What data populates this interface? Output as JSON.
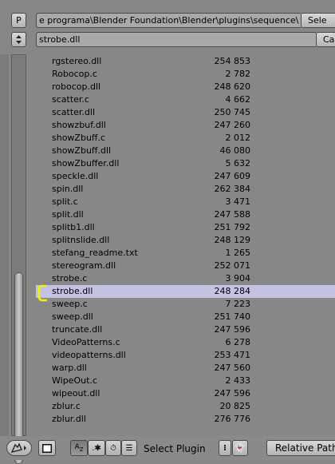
{
  "header": {
    "parent_button_label": "P",
    "directory_path": "e programa\\Blender Foundation\\Blender\\plugins\\sequence\\",
    "select_button_label": "Sele",
    "filename_value": "strobe.dll",
    "cancel_button_label": "Ca"
  },
  "files": [
    {
      "name": "rgstereo.dll",
      "size": "254 853"
    },
    {
      "name": "Robocop.c",
      "size": "2 782"
    },
    {
      "name": "robocop.dll",
      "size": "248 620"
    },
    {
      "name": "scatter.c",
      "size": "4 662"
    },
    {
      "name": "scatter.dll",
      "size": "250 745"
    },
    {
      "name": "showzbuf.dll",
      "size": "247 260"
    },
    {
      "name": "showZbuff.c",
      "size": "2 012"
    },
    {
      "name": "showZbuff.dll",
      "size": "46 080"
    },
    {
      "name": "showZbuffer.dll",
      "size": "5 632"
    },
    {
      "name": "speckle.dll",
      "size": "247 609"
    },
    {
      "name": "spin.dll",
      "size": "262 384"
    },
    {
      "name": "split.c",
      "size": "3 471"
    },
    {
      "name": "split.dll",
      "size": "247 588"
    },
    {
      "name": "splitb1.dll",
      "size": "251 792"
    },
    {
      "name": "splitnslide.dll",
      "size": "248 129"
    },
    {
      "name": "stefang_readme.txt",
      "size": "1 265"
    },
    {
      "name": "stereogram.dll",
      "size": "252 071"
    },
    {
      "name": "strobe.c",
      "size": "3 904"
    },
    {
      "name": "strobe.dll",
      "size": "248 284",
      "selected": true
    },
    {
      "name": "sweep.c",
      "size": "7 223"
    },
    {
      "name": "sweep.dll",
      "size": "251 740"
    },
    {
      "name": "truncate.dll",
      "size": "247 596"
    },
    {
      "name": "VideoPatterns.c",
      "size": "6 278"
    },
    {
      "name": "videopatterns.dll",
      "size": "253 471"
    },
    {
      "name": "warp.dll",
      "size": "247 560"
    },
    {
      "name": "WipeOut.c",
      "size": "2 433"
    },
    {
      "name": "wipeout.dll",
      "size": "247 596"
    },
    {
      "name": "zblur.c",
      "size": "20 825"
    },
    {
      "name": "zblur.dll",
      "size": "276 776"
    }
  ],
  "footer": {
    "window_type_icon": "file-browser-icon",
    "sort_alpha_icon": "sort-alphabetical-icon",
    "sort_ext_icon": "sort-extension-icon",
    "sort_time_icon": "sort-time-icon",
    "sort_size_icon": "sort-size-icon",
    "title_label": "Select Plugin",
    "relative_path_label": "Relative Path"
  },
  "colors": {
    "background": "#878787",
    "selected_row": "#c3c2e3",
    "selection_marker": "#f2f200"
  }
}
